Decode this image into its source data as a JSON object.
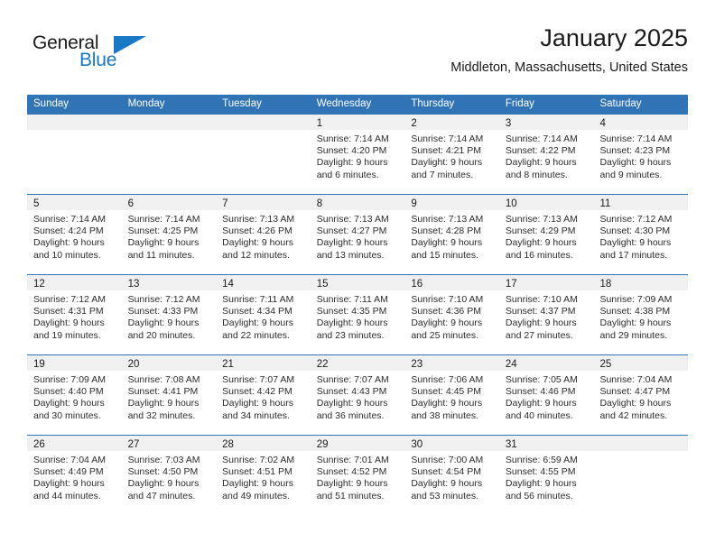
{
  "logo": {
    "word_one": "General",
    "word_two": "Blue",
    "triangle_color": "#1878c4",
    "icon": "general-blue-logo"
  },
  "header": {
    "title": "January 2025",
    "subtitle": "Middleton, Massachusetts, United States"
  },
  "theme": {
    "header_bg": "#3074b6",
    "daynum_band_bg": "#f0f0f0",
    "row_divider": "#3074b6",
    "text": "#222222"
  },
  "weekdays": [
    "Sunday",
    "Monday",
    "Tuesday",
    "Wednesday",
    "Thursday",
    "Friday",
    "Saturday"
  ],
  "weeks": [
    [
      {
        "day": "",
        "sunrise": "",
        "sunset": "",
        "daylight": ""
      },
      {
        "day": "",
        "sunrise": "",
        "sunset": "",
        "daylight": ""
      },
      {
        "day": "",
        "sunrise": "",
        "sunset": "",
        "daylight": ""
      },
      {
        "day": "1",
        "sunrise": "Sunrise: 7:14 AM",
        "sunset": "Sunset: 4:20 PM",
        "daylight": "Daylight: 9 hours and 6 minutes."
      },
      {
        "day": "2",
        "sunrise": "Sunrise: 7:14 AM",
        "sunset": "Sunset: 4:21 PM",
        "daylight": "Daylight: 9 hours and 7 minutes."
      },
      {
        "day": "3",
        "sunrise": "Sunrise: 7:14 AM",
        "sunset": "Sunset: 4:22 PM",
        "daylight": "Daylight: 9 hours and 8 minutes."
      },
      {
        "day": "4",
        "sunrise": "Sunrise: 7:14 AM",
        "sunset": "Sunset: 4:23 PM",
        "daylight": "Daylight: 9 hours and 9 minutes."
      }
    ],
    [
      {
        "day": "5",
        "sunrise": "Sunrise: 7:14 AM",
        "sunset": "Sunset: 4:24 PM",
        "daylight": "Daylight: 9 hours and 10 minutes."
      },
      {
        "day": "6",
        "sunrise": "Sunrise: 7:14 AM",
        "sunset": "Sunset: 4:25 PM",
        "daylight": "Daylight: 9 hours and 11 minutes."
      },
      {
        "day": "7",
        "sunrise": "Sunrise: 7:13 AM",
        "sunset": "Sunset: 4:26 PM",
        "daylight": "Daylight: 9 hours and 12 minutes."
      },
      {
        "day": "8",
        "sunrise": "Sunrise: 7:13 AM",
        "sunset": "Sunset: 4:27 PM",
        "daylight": "Daylight: 9 hours and 13 minutes."
      },
      {
        "day": "9",
        "sunrise": "Sunrise: 7:13 AM",
        "sunset": "Sunset: 4:28 PM",
        "daylight": "Daylight: 9 hours and 15 minutes."
      },
      {
        "day": "10",
        "sunrise": "Sunrise: 7:13 AM",
        "sunset": "Sunset: 4:29 PM",
        "daylight": "Daylight: 9 hours and 16 minutes."
      },
      {
        "day": "11",
        "sunrise": "Sunrise: 7:12 AM",
        "sunset": "Sunset: 4:30 PM",
        "daylight": "Daylight: 9 hours and 17 minutes."
      }
    ],
    [
      {
        "day": "12",
        "sunrise": "Sunrise: 7:12 AM",
        "sunset": "Sunset: 4:31 PM",
        "daylight": "Daylight: 9 hours and 19 minutes."
      },
      {
        "day": "13",
        "sunrise": "Sunrise: 7:12 AM",
        "sunset": "Sunset: 4:33 PM",
        "daylight": "Daylight: 9 hours and 20 minutes."
      },
      {
        "day": "14",
        "sunrise": "Sunrise: 7:11 AM",
        "sunset": "Sunset: 4:34 PM",
        "daylight": "Daylight: 9 hours and 22 minutes."
      },
      {
        "day": "15",
        "sunrise": "Sunrise: 7:11 AM",
        "sunset": "Sunset: 4:35 PM",
        "daylight": "Daylight: 9 hours and 23 minutes."
      },
      {
        "day": "16",
        "sunrise": "Sunrise: 7:10 AM",
        "sunset": "Sunset: 4:36 PM",
        "daylight": "Daylight: 9 hours and 25 minutes."
      },
      {
        "day": "17",
        "sunrise": "Sunrise: 7:10 AM",
        "sunset": "Sunset: 4:37 PM",
        "daylight": "Daylight: 9 hours and 27 minutes."
      },
      {
        "day": "18",
        "sunrise": "Sunrise: 7:09 AM",
        "sunset": "Sunset: 4:38 PM",
        "daylight": "Daylight: 9 hours and 29 minutes."
      }
    ],
    [
      {
        "day": "19",
        "sunrise": "Sunrise: 7:09 AM",
        "sunset": "Sunset: 4:40 PM",
        "daylight": "Daylight: 9 hours and 30 minutes."
      },
      {
        "day": "20",
        "sunrise": "Sunrise: 7:08 AM",
        "sunset": "Sunset: 4:41 PM",
        "daylight": "Daylight: 9 hours and 32 minutes."
      },
      {
        "day": "21",
        "sunrise": "Sunrise: 7:07 AM",
        "sunset": "Sunset: 4:42 PM",
        "daylight": "Daylight: 9 hours and 34 minutes."
      },
      {
        "day": "22",
        "sunrise": "Sunrise: 7:07 AM",
        "sunset": "Sunset: 4:43 PM",
        "daylight": "Daylight: 9 hours and 36 minutes."
      },
      {
        "day": "23",
        "sunrise": "Sunrise: 7:06 AM",
        "sunset": "Sunset: 4:45 PM",
        "daylight": "Daylight: 9 hours and 38 minutes."
      },
      {
        "day": "24",
        "sunrise": "Sunrise: 7:05 AM",
        "sunset": "Sunset: 4:46 PM",
        "daylight": "Daylight: 9 hours and 40 minutes."
      },
      {
        "day": "25",
        "sunrise": "Sunrise: 7:04 AM",
        "sunset": "Sunset: 4:47 PM",
        "daylight": "Daylight: 9 hours and 42 minutes."
      }
    ],
    [
      {
        "day": "26",
        "sunrise": "Sunrise: 7:04 AM",
        "sunset": "Sunset: 4:49 PM",
        "daylight": "Daylight: 9 hours and 44 minutes."
      },
      {
        "day": "27",
        "sunrise": "Sunrise: 7:03 AM",
        "sunset": "Sunset: 4:50 PM",
        "daylight": "Daylight: 9 hours and 47 minutes."
      },
      {
        "day": "28",
        "sunrise": "Sunrise: 7:02 AM",
        "sunset": "Sunset: 4:51 PM",
        "daylight": "Daylight: 9 hours and 49 minutes."
      },
      {
        "day": "29",
        "sunrise": "Sunrise: 7:01 AM",
        "sunset": "Sunset: 4:52 PM",
        "daylight": "Daylight: 9 hours and 51 minutes."
      },
      {
        "day": "30",
        "sunrise": "Sunrise: 7:00 AM",
        "sunset": "Sunset: 4:54 PM",
        "daylight": "Daylight: 9 hours and 53 minutes."
      },
      {
        "day": "31",
        "sunrise": "Sunrise: 6:59 AM",
        "sunset": "Sunset: 4:55 PM",
        "daylight": "Daylight: 9 hours and 56 minutes."
      },
      {
        "day": "",
        "sunrise": "",
        "sunset": "",
        "daylight": ""
      }
    ]
  ]
}
